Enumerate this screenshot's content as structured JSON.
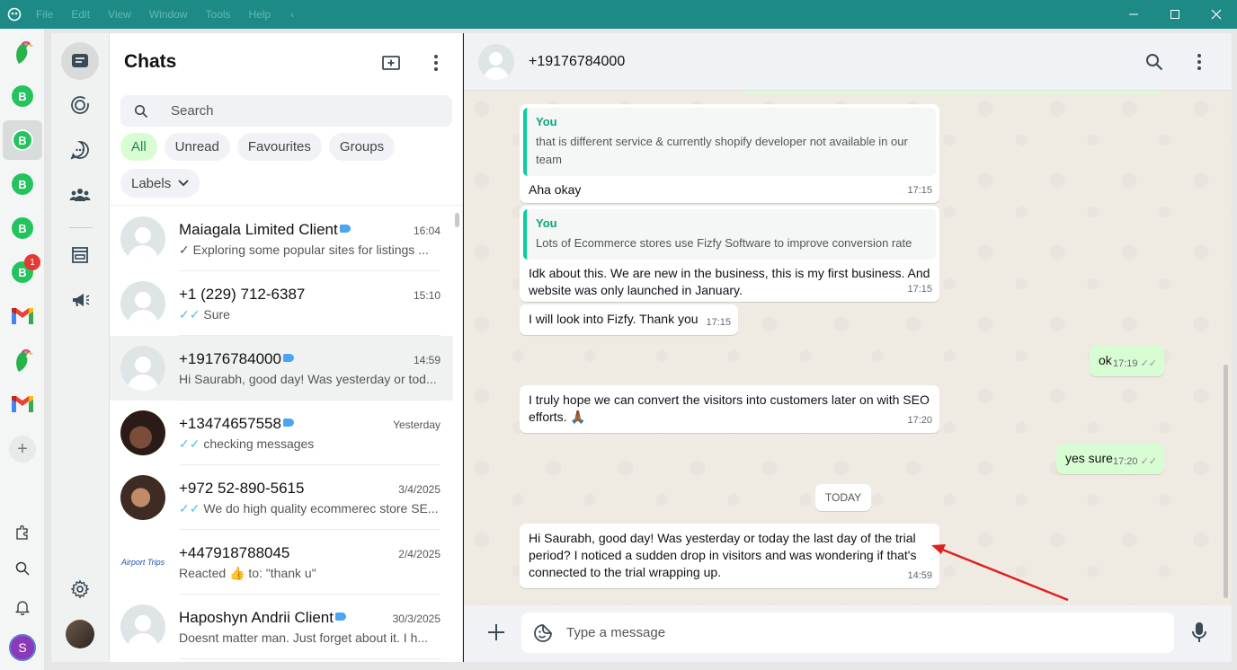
{
  "titlebar": {
    "menu": [
      "File",
      "Edit",
      "View",
      "Window",
      "Tools",
      "Help"
    ],
    "back": "‹",
    "controls": {
      "minimize": "—",
      "maximize": "☐",
      "close": "✕"
    }
  },
  "rail": {
    "accounts": [
      {
        "icon": "parrot-icon"
      },
      {
        "icon": "whatsapp-business-icon",
        "letter": "B"
      },
      {
        "icon": "whatsapp-business-icon",
        "letter": "B",
        "active": true
      },
      {
        "icon": "whatsapp-business-icon",
        "letter": "B"
      },
      {
        "icon": "whatsapp-business-icon",
        "letter": "B"
      },
      {
        "icon": "whatsapp-business-icon",
        "letter": "B",
        "badge": "1"
      },
      {
        "icon": "gmail-icon"
      },
      {
        "icon": "parrot-icon"
      },
      {
        "icon": "gmail-icon"
      }
    ],
    "add_label": "+",
    "profile_letter": "S"
  },
  "chatlist": {
    "title": "Chats",
    "search_placeholder": "Search",
    "filters": [
      "All",
      "Unread",
      "Favourites",
      "Groups"
    ],
    "labels_button": "Labels",
    "chats": [
      {
        "name": "Maiagala Limited Client",
        "tag": true,
        "time": "16:04",
        "tick": "✓",
        "tick_color": "grey",
        "message": "Exploring some popular sites for listings ..."
      },
      {
        "name": "+1 (229) 712-6387",
        "tag": false,
        "time": "15:10",
        "tick": "✓✓",
        "tick_color": "blue",
        "message": "Sure"
      },
      {
        "name": "+19176784000",
        "tag": true,
        "time": "14:59",
        "tick": "",
        "tick_color": "",
        "message": "Hi Saurabh, good day! Was yesterday or tod...",
        "selected": true
      },
      {
        "name": "+13474657558",
        "tag": true,
        "time": "Yesterday",
        "tick": "✓✓",
        "tick_color": "blue",
        "message": "checking messages"
      },
      {
        "name": "+972 52-890-5615",
        "tag": false,
        "time": "3/4/2025",
        "tick": "✓✓",
        "tick_color": "blue",
        "message": "We do high quality ecommerec store SE..."
      },
      {
        "name": "+447918788045",
        "tag": false,
        "time": "2/4/2025",
        "tick": "",
        "tick_color": "",
        "message": "Reacted 👍 to: \"thank u\""
      },
      {
        "name": "Haposhyn Andrii Client",
        "tag": true,
        "time": "30/3/2025",
        "tick": "",
        "tick_color": "",
        "message": "Doesnt matter man. Just forget about it. I h..."
      }
    ],
    "airport_logo_text": "Airport Trips"
  },
  "conversation": {
    "contact": "+19176784000",
    "messages": [
      {
        "dir": "in",
        "quote_author": "You",
        "quote_text": "that is different service & currently shopify developer not available in our team",
        "text": "Aha okay",
        "time": "17:15"
      },
      {
        "dir": "in",
        "quote_author": "You",
        "quote_text": "Lots of Ecommerce stores use Fizfy Software to improve conversion rate",
        "text": "Idk about this. We are new in the business, this is my first business. And website was only launched in January.",
        "time": "17:15"
      },
      {
        "dir": "in",
        "text": "I will look into Fizfy. Thank you",
        "time": "17:15"
      },
      {
        "dir": "out",
        "text": "ok",
        "time": "17:19"
      },
      {
        "dir": "in",
        "text": "I truly hope we can convert the visitors into customers later on with SEO efforts. 🙏🏾",
        "time": "17:20"
      },
      {
        "dir": "out",
        "text": "yes sure",
        "time": "17:20"
      },
      {
        "dir": "in",
        "text": "Hi Saurabh, good day! Was yesterday or today the last day of the trial period? I noticed a sudden drop in visitors and was wondering if that's connected to the trial wrapping up.",
        "time": "14:59"
      }
    ],
    "date_divider": "TODAY",
    "composer_placeholder": "Type a message",
    "read_ticks": "✓✓"
  },
  "colors": {
    "titlebar": "#1d8a86",
    "accent_green": "#25c35f",
    "outgoing_bubble": "#d9fdd3",
    "chat_bg": "#efeae2",
    "annotation_arrow": "#e02020",
    "blue_tick": "#53bdeb"
  }
}
